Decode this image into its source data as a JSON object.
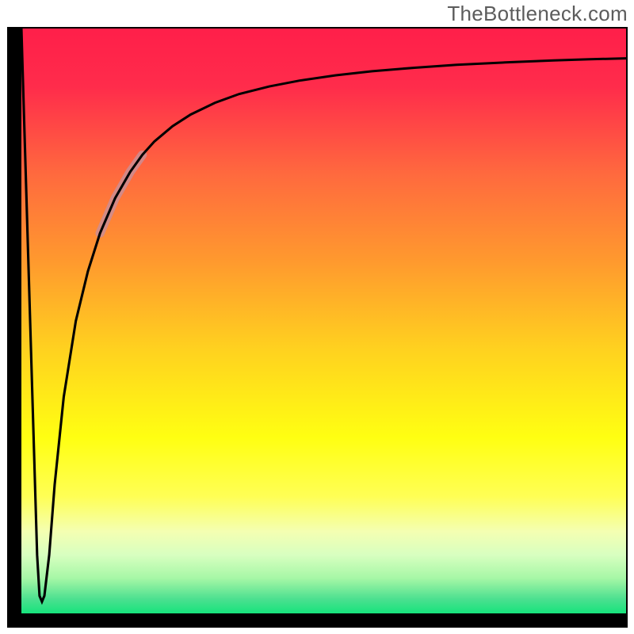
{
  "watermark": "TheBottleneck.com",
  "chart_data": {
    "type": "line",
    "title": "",
    "xlabel": "",
    "ylabel": "",
    "xlim": [
      0,
      100
    ],
    "ylim": [
      0,
      100
    ],
    "grid": false,
    "legend": false,
    "series": [
      {
        "name": "curve",
        "x": [
          0.0,
          1.3,
          2.6,
          3.0,
          3.4,
          3.8,
          4.6,
          5.5,
          7.0,
          9.0,
          11.0,
          13.0,
          15.5,
          18.0,
          20.0,
          22.0,
          25.0,
          28.0,
          32.0,
          36.0,
          41.0,
          46.0,
          52.0,
          58.0,
          65.0,
          72.0,
          80.0,
          88.0,
          94.0,
          100.0
        ],
        "values": [
          100.0,
          55.0,
          10.0,
          3.0,
          2.0,
          3.0,
          10.0,
          22.0,
          37.0,
          50.0,
          58.5,
          65.0,
          71.0,
          75.5,
          78.4,
          80.7,
          83.3,
          85.3,
          87.3,
          88.8,
          90.1,
          91.1,
          92.0,
          92.7,
          93.3,
          93.8,
          94.2,
          94.55,
          94.75,
          94.9
        ]
      }
    ],
    "highlight_range_x": [
      13.0,
      20.0
    ],
    "gradient_stops": [
      {
        "pos": 0.0,
        "color": "#ff1f4a"
      },
      {
        "pos": 0.1,
        "color": "#ff2c4b"
      },
      {
        "pos": 0.25,
        "color": "#ff6a3e"
      },
      {
        "pos": 0.4,
        "color": "#ff9a2e"
      },
      {
        "pos": 0.55,
        "color": "#ffd21f"
      },
      {
        "pos": 0.7,
        "color": "#ffff12"
      },
      {
        "pos": 0.8,
        "color": "#ffff55"
      },
      {
        "pos": 0.86,
        "color": "#f4ffb2"
      },
      {
        "pos": 0.9,
        "color": "#d8ffc0"
      },
      {
        "pos": 0.94,
        "color": "#a6f7a6"
      },
      {
        "pos": 0.975,
        "color": "#4de090"
      },
      {
        "pos": 1.0,
        "color": "#16e37c"
      }
    ]
  }
}
